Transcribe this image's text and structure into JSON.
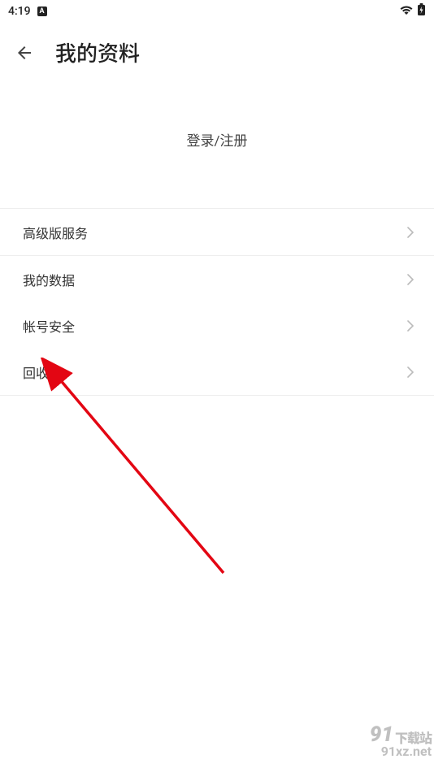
{
  "statusBar": {
    "time": "4:19",
    "indicator": "A"
  },
  "header": {
    "title": "我的资料"
  },
  "login": {
    "label": "登录/注册"
  },
  "menu": {
    "premium": "高级版服务",
    "mydata": "我的数据",
    "security": "帐号安全",
    "recycle": "回收站"
  },
  "watermark": {
    "brand_num": "91",
    "brand_cn": "下载站",
    "url": "91xz.net"
  }
}
